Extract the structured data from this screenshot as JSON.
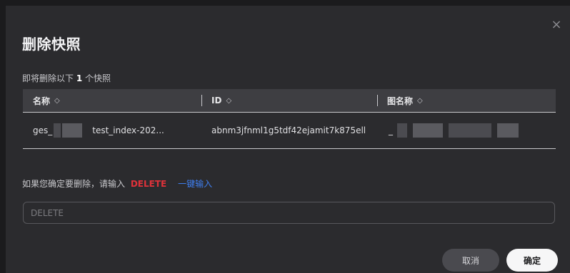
{
  "dialog": {
    "title": "删除快照",
    "close_icon": "×",
    "subtitle_prefix": "即将删除以下",
    "subtitle_count": "1",
    "subtitle_suffix": "个快照"
  },
  "table": {
    "columns": [
      {
        "label": "名称",
        "sort_icon": "sort-icon"
      },
      {
        "label": "ID",
        "sort_icon": "sort-icon"
      },
      {
        "label": "图名称",
        "sort_icon": "sort-icon"
      }
    ],
    "rows": [
      {
        "name_prefix": "ges_",
        "name_suffix": "test_index-202...",
        "id": "abnm3jfnml1g5tdf42ejamit7k875ell",
        "graph_name_prefix": "_"
      }
    ]
  },
  "confirm": {
    "prefix": "如果您确定要删除，请输入",
    "keyword": "DELETE",
    "one_click": "一键输入"
  },
  "input": {
    "placeholder": "DELETE",
    "value": ""
  },
  "buttons": {
    "cancel": "取消",
    "ok": "确定"
  },
  "colors": {
    "keyword": "#e0323a",
    "link": "#3f7ff0",
    "ok_bg": "#f6f6f7"
  }
}
